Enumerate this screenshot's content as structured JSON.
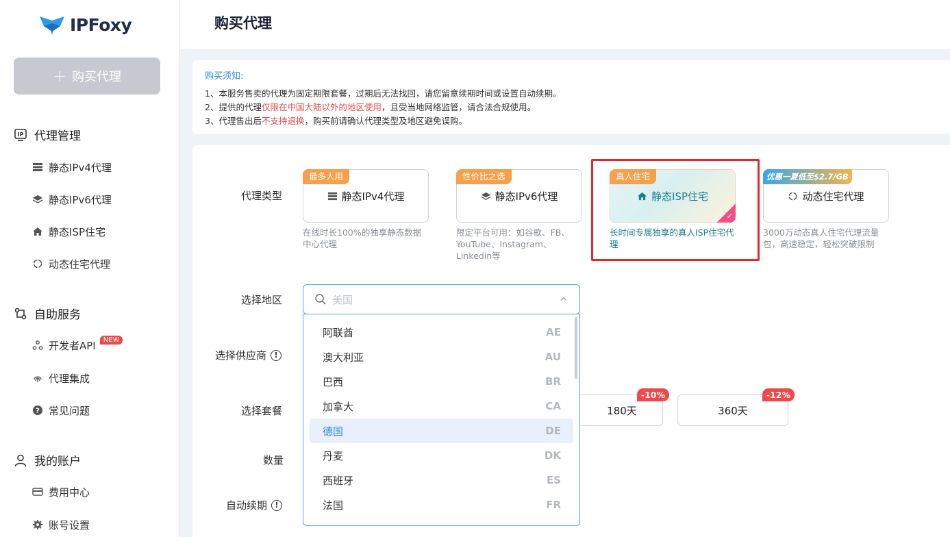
{
  "brand": {
    "name": "IPFoxy"
  },
  "sidebar": {
    "buy_button": "购买代理",
    "groups": [
      {
        "title": "代理管理",
        "items": [
          "静态IPv4代理",
          "静态IPv6代理",
          "静态ISP住宅",
          "动态住宅代理"
        ]
      },
      {
        "title": "自助服务",
        "items": [
          "开发者API",
          "代理集成",
          "常见问题"
        ],
        "new_badge": "NEW"
      },
      {
        "title": "我的账户",
        "items": [
          "费用中心",
          "账号设置"
        ]
      }
    ]
  },
  "page": {
    "title": "购买代理"
  },
  "notice": {
    "title": "购买须知:",
    "line1": "1、本服务售卖的代理为固定期限套餐，过期后无法找回，请您留意续期时间或设置自动续期。",
    "line2_pre": "2、提供的代理",
    "line2_red": "仅限在中国大陆以外的地区使用",
    "line2_post": "，且受当地网络监管，请合法合规使用。",
    "line3_pre": "3、代理售出后",
    "line3_red": "不支持退换",
    "line3_post": "，购买前请确认代理类型及地区避免误购。"
  },
  "form": {
    "proxy_type_label": "代理类型",
    "region_label": "选择地区",
    "supplier_label": "选择供应商",
    "plan_label": "选择套餐",
    "quantity_label": "数量",
    "auto_renew_label": "自动续期"
  },
  "proxy_types": [
    {
      "tag": "最多人用",
      "name": "静态IPv4代理",
      "desc": "在线时长100%的独享静态数据中心代理"
    },
    {
      "tag": "性价比之选",
      "name": "静态IPv6代理",
      "desc": "限定平台可用：如谷歌、FB、YouTube、Instagram、Linkedin等"
    },
    {
      "tag": "真人住宅",
      "name": "静态ISP住宅",
      "desc": "长时间专属独享的真人ISP住宅代理",
      "selected": true
    },
    {
      "tag": "优惠一夏低至$2.7/GB",
      "name": "动态住宅代理",
      "desc": "3000万动态真人住宅代理流量包，高速稳定，轻松突破限制"
    }
  ],
  "region": {
    "placeholder": "美国",
    "options": [
      {
        "name": "阿联酋",
        "code": "AE"
      },
      {
        "name": "澳大利亚",
        "code": "AU"
      },
      {
        "name": "巴西",
        "code": "BR"
      },
      {
        "name": "加拿大",
        "code": "CA"
      },
      {
        "name": "德国",
        "code": "DE",
        "active": true
      },
      {
        "name": "丹麦",
        "code": "DK"
      },
      {
        "name": "西班牙",
        "code": "ES"
      },
      {
        "name": "法国",
        "code": "FR"
      }
    ]
  },
  "plans": [
    {
      "label": "180天",
      "discount": "-10%"
    },
    {
      "label": "360天",
      "discount": "-12%"
    }
  ],
  "colors": {
    "accent": "#2b8ae0",
    "danger": "#f04848",
    "highlight_border": "#e8262a"
  }
}
